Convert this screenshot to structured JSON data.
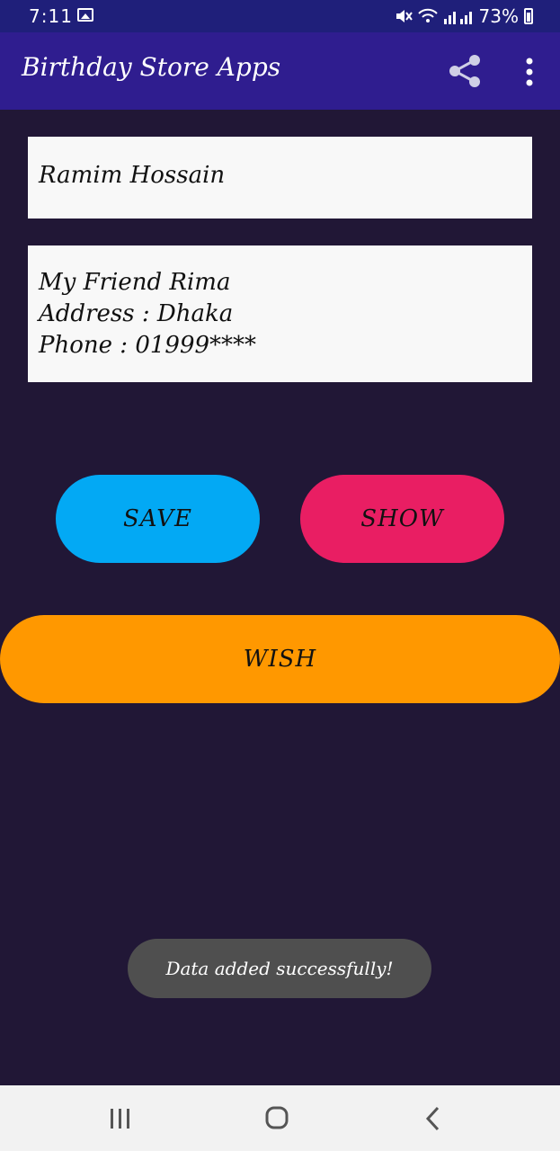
{
  "status_bar": {
    "time": "7:11",
    "battery": "73%"
  },
  "app_bar": {
    "title": "Birthday Store Apps"
  },
  "form": {
    "name_value": "Ramim Hossain",
    "notes_value": "My Friend Rima\nAddress : Dhaka\nPhone : 01999****"
  },
  "buttons": {
    "save": "SAVE",
    "show": "SHOW",
    "wish": "WISH"
  },
  "toast": {
    "message": "Data added successfully!"
  },
  "colors": {
    "background": "#211736",
    "app_bar": "#2f1d8f",
    "save": "#03a9f4",
    "show": "#e91e63",
    "wish": "#ff9800",
    "toast": "#4f4f4f"
  },
  "icons": {
    "share": "share-icon",
    "more": "more-vert-icon",
    "recents": "recents-icon",
    "home": "home-icon",
    "back": "back-icon"
  }
}
